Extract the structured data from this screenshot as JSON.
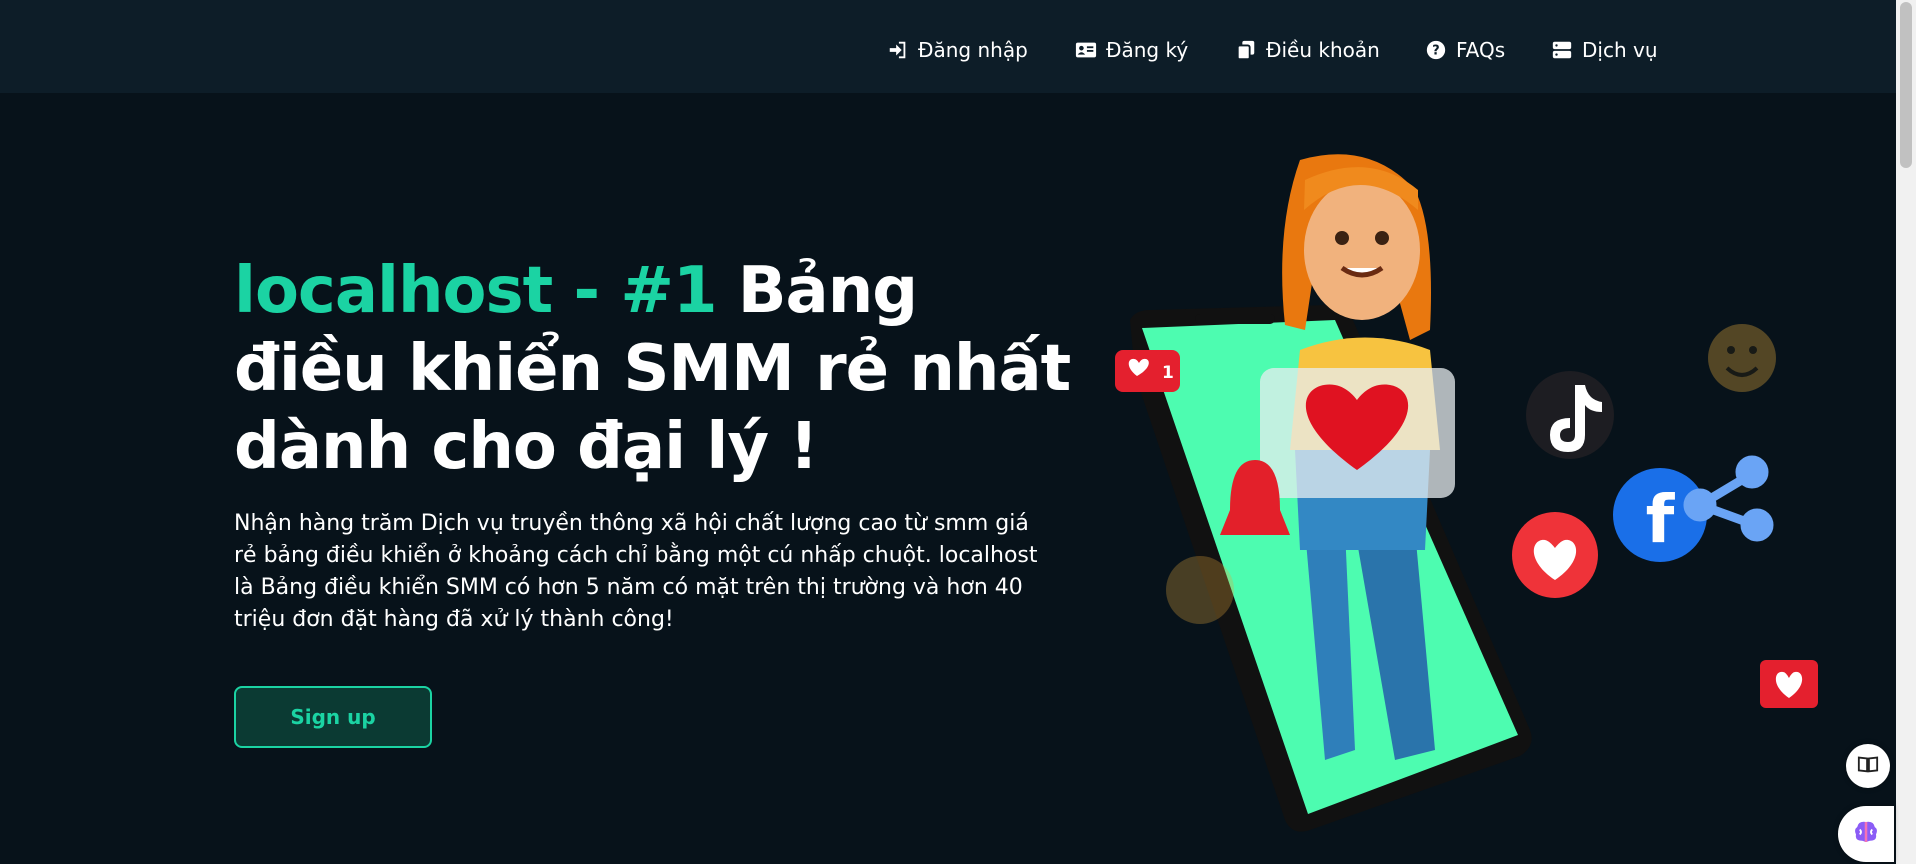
{
  "nav": {
    "login": {
      "label": "Đăng nhập",
      "icon": "sign-in-icon"
    },
    "register": {
      "label": "Đăng ký",
      "icon": "id-card-icon"
    },
    "terms": {
      "label": "Điều khoản",
      "icon": "copy-icon"
    },
    "faqs": {
      "label": "FAQs",
      "icon": "question-circle-icon"
    },
    "services": {
      "label": "Dịch vụ",
      "icon": "server-icon"
    }
  },
  "hero": {
    "title_accent": "localhost - #1",
    "title_rest": " Bảng điều khiển SMM rẻ nhất dành cho đại lý !",
    "description": "Nhận hàng trăm Dịch vụ truyền thông xã hội chất lượng cao từ smm giá rẻ bảng điều khiển ở khoảng cách chỉ bằng một cú nhấp chuột. localhost là Bảng điều khiển SMM có hơn 5 năm có mặt trên thị trường và hơn 40 triệu đơn đặt hàng đã xử lý thành công!",
    "signup_label": "Sign up"
  },
  "illustration": {
    "like_badge_count": "1"
  },
  "colors": {
    "accent": "#1bd3a3",
    "background": "#07121a",
    "navbar": "#0d1d28",
    "phone_screen": "#4dfcb0"
  },
  "floating": {
    "reader_icon": "book-icon",
    "assistant_icon": "brain-icon"
  }
}
